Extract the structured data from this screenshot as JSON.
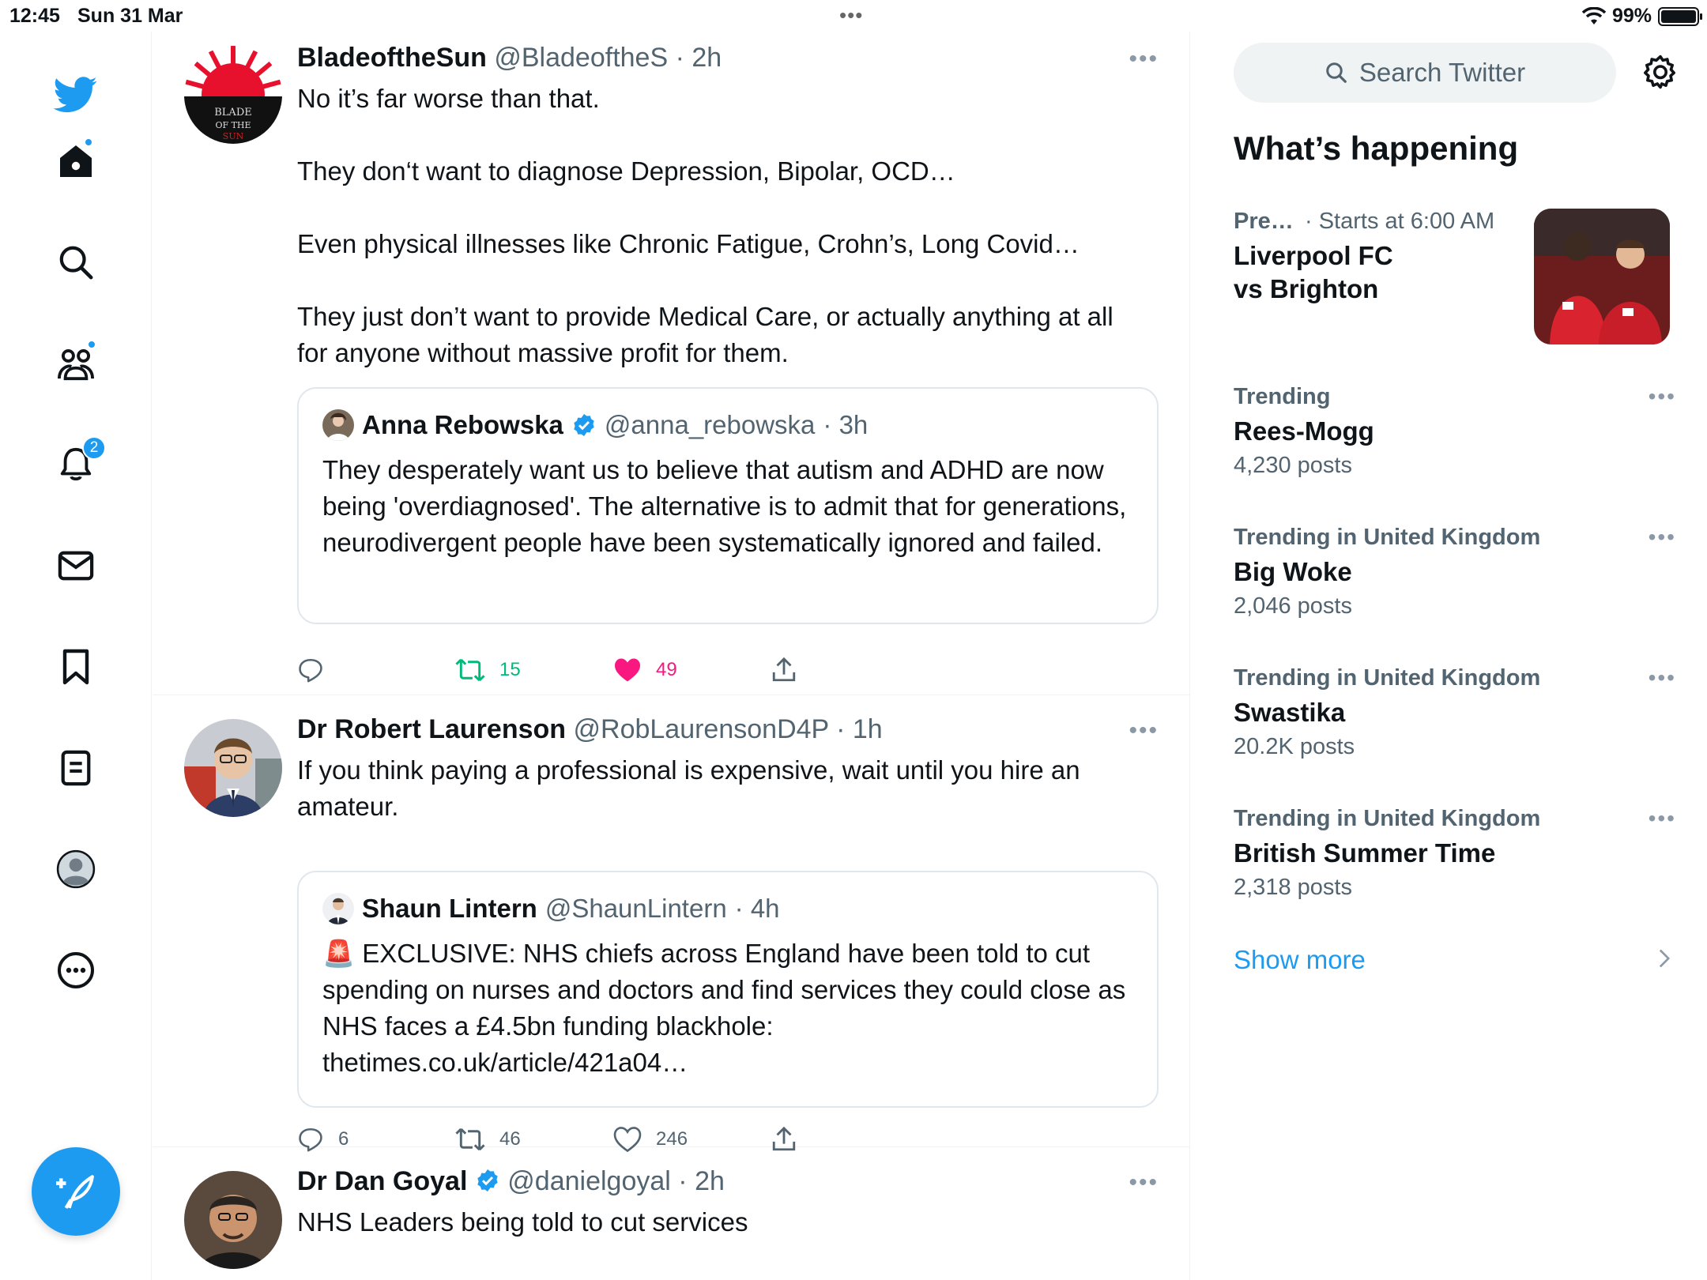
{
  "status_bar": {
    "time": "12:45",
    "date": "Sun 31 Mar",
    "battery": "99%",
    "battery_level": 0.99
  },
  "nav": {
    "notifications_badge": "2"
  },
  "tweets": [
    {
      "name": "BladeoftheSun",
      "handle": "@BladeoftheS",
      "time": "· 2h",
      "text": "No it’s far worse than that.\n\nThey don‘t want to diagnose Depression, Bipolar, OCD…\n\nEven physical illnesses like Chronic Fatigue, Crohn’s, Long Covid…\n\nThey just don’t want to provide Medical Care, or actually anything at all for anyone without massive profit for them.",
      "avatar_text": "BLADE OF THE SUN",
      "quote": {
        "name": "Anna Rebowska",
        "handle": "@anna_rebowska",
        "time": "· 3h",
        "text": "They desperately want us to believe that autism and ADHD are now being 'overdiagnosed'.  The alternative is to admit that for generations, neurodivergent people have been systematically ignored and failed."
      },
      "replies": "",
      "retweets": "15",
      "likes": "49"
    },
    {
      "name": "Dr Robert Laurenson",
      "handle": "@RobLaurensonD4P",
      "time": "· 1h",
      "text": "If you think paying a professional is expensive, wait until you hire an amateur.",
      "quote": {
        "name": "Shaun Lintern",
        "handle": "@ShaunLintern",
        "time": "· 4h",
        "text": "🚨 EXCLUSIVE: NHS chiefs across England have been told to cut spending on nurses and doctors and find services they could close as NHS faces a £4.5bn funding blackhole: thetimes.co.uk/article/421a04…"
      },
      "replies": "6",
      "retweets": "46",
      "likes": "246"
    },
    {
      "name": "Dr Dan Goyal",
      "handle": "@danielgoyal",
      "time": "· 2h",
      "text": "NHS Leaders being told to cut services"
    }
  ],
  "sidebar": {
    "search_placeholder": "Search Twitter",
    "title": "What’s happening",
    "event": {
      "context": "Pre…",
      "starts": "· Starts at 6:00 AM",
      "title": "Liverpool FC vs Brighton"
    },
    "trends": [
      {
        "context": "Trending",
        "title": "Rees-Mogg",
        "count": "4,230 posts"
      },
      {
        "context": "Trending in United Kingdom",
        "title": "Big Woke",
        "count": "2,046 posts"
      },
      {
        "context": "Trending in United Kingdom",
        "title": "Swastika",
        "count": "20.2K posts"
      },
      {
        "context": "Trending in United Kingdom",
        "title": "British Summer Time",
        "count": "2,318 posts"
      }
    ],
    "show_more": "Show more"
  },
  "colors": {
    "accent": "#1d9bf0",
    "like": "#f91880",
    "retweet": "#00ba7c",
    "muted": "#536471"
  },
  "icons": [
    "twitter-logo-icon",
    "home-icon",
    "search-icon",
    "communities-icon",
    "notifications-icon",
    "messages-icon",
    "bookmarks-icon",
    "lists-icon",
    "profile-icon",
    "more-icon",
    "compose-icon",
    "reply-icon",
    "retweet-icon",
    "like-icon",
    "share-icon",
    "verified-icon",
    "settings-icon",
    "chevron-right-icon"
  ]
}
